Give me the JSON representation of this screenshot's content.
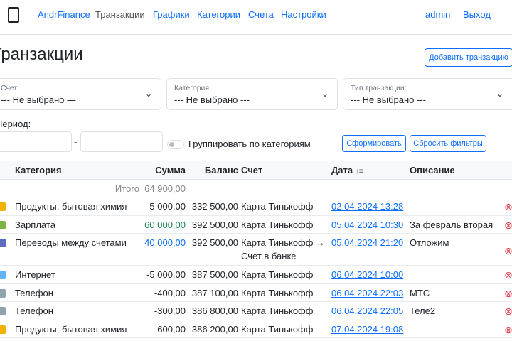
{
  "nav": {
    "brand": "AndrFinance",
    "items": [
      "Транзакции",
      "Графики",
      "Категории",
      "Счета",
      "Настройки"
    ],
    "user": "admin",
    "logout": "Выход"
  },
  "page": {
    "title": "Транзакции",
    "add_button": "Добавить транзакцию"
  },
  "filters": {
    "account": {
      "label": "Счет:",
      "value": "--- Не выбрано ---"
    },
    "category": {
      "label": "Категория:",
      "value": "--- Не выбрано ---"
    },
    "type": {
      "label": "Тип транзакции:",
      "value": "--- Не выбрано ---"
    },
    "period_label": "Период:",
    "period_sep": "-",
    "period_from": "",
    "period_to": "",
    "group_toggle": "Группировать по категориям",
    "group_checked": false,
    "build_button": "Сформировать",
    "reset_button": "Сбросить фильтры"
  },
  "table": {
    "headers": {
      "category": "Категория",
      "sum": "Сумма",
      "balance": "Баланс",
      "account": "Счет",
      "date": "Дата",
      "description": "Описание"
    },
    "total_label": "Итого",
    "total_value": "64 900,00",
    "rows": [
      {
        "category": "Продукты, бытовая химия",
        "icon": "bread-icon",
        "sum": "-5 000,00",
        "type": "expense",
        "balance": "332 500,00",
        "account": "Карта Тинькофф",
        "date": "02.04.2024 13:28",
        "description": ""
      },
      {
        "category": "Зарплата",
        "icon": "money-icon",
        "sum": "60 000,00",
        "type": "income",
        "balance": "392 500,00",
        "account": "Карта Тинькофф",
        "date": "05.04.2024 10:30",
        "description": "За февраль вторая"
      },
      {
        "category": "Переводы между счетами",
        "icon": "transfer-icon",
        "sum": "40 000,00",
        "type": "transfer",
        "balance": "392 500,00",
        "account": "Карта Тинькофф → Счет в банке",
        "date": "05.04.2024 21:20",
        "description": "Отложим"
      },
      {
        "category": "Интернет",
        "icon": "globe-icon",
        "sum": "-5 000,00",
        "type": "expense",
        "balance": "387 500,00",
        "account": "Карта Тинькофф",
        "date": "06.04.2024 10:00",
        "description": ""
      },
      {
        "category": "Телефон",
        "icon": "phone-icon",
        "sum": "-400,00",
        "type": "expense",
        "balance": "387 100,00",
        "account": "Карта Тинькофф",
        "date": "06.04.2024 22:03",
        "description": "МТС"
      },
      {
        "category": "Телефон",
        "icon": "phone-icon",
        "sum": "-300,00",
        "type": "expense",
        "balance": "386 800,00",
        "account": "Карта Тинькофф",
        "date": "06.04.2024 22:05",
        "description": "Теле2"
      },
      {
        "category": "Продукты, бытовая химия",
        "icon": "bread-icon",
        "sum": "-600,00",
        "type": "expense",
        "balance": "386 200,00",
        "account": "Карта Тинькофф",
        "date": "07.04.2024 19:08",
        "description": ""
      }
    ]
  },
  "colors": {
    "primary": "#0d6efd",
    "income": "#198754",
    "danger": "#dc3545"
  }
}
